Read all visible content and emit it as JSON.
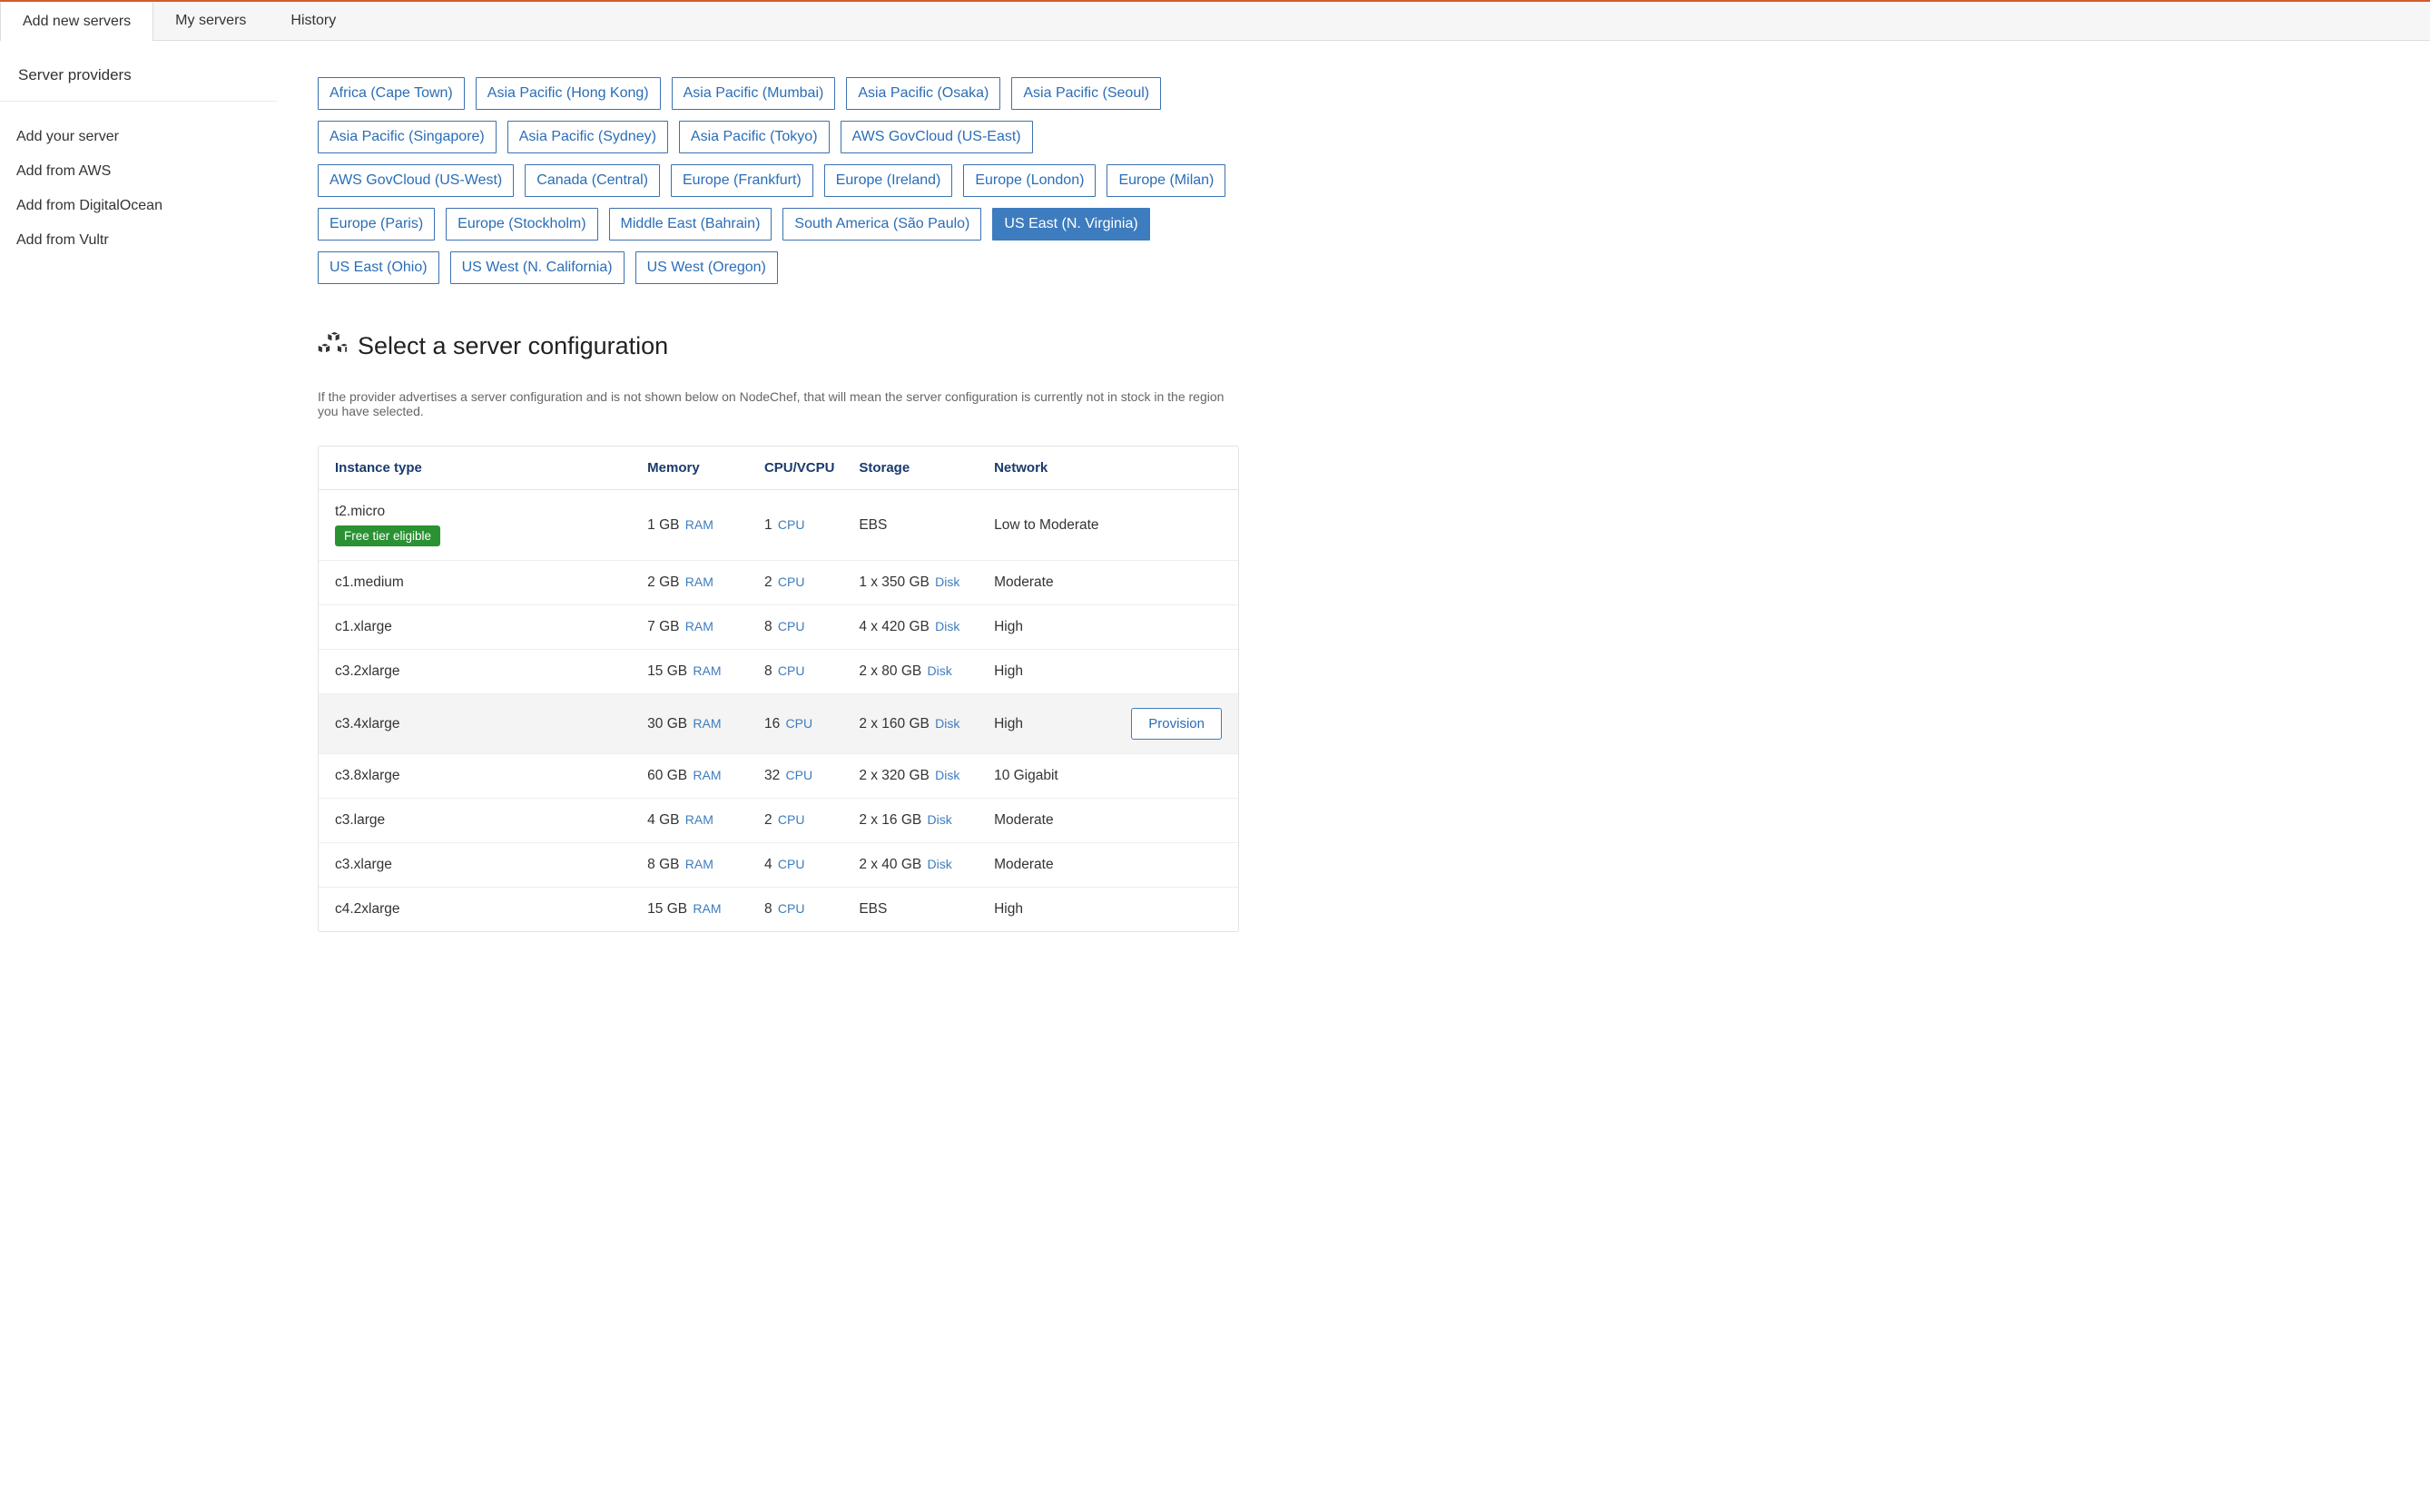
{
  "tabs": [
    {
      "label": "Add new servers",
      "active": true
    },
    {
      "label": "My servers",
      "active": false
    },
    {
      "label": "History",
      "active": false
    }
  ],
  "sidebar": {
    "header": "Server providers",
    "items": [
      {
        "label": "Add your server"
      },
      {
        "label": "Add from AWS"
      },
      {
        "label": "Add from DigitalOcean"
      },
      {
        "label": "Add from Vultr"
      }
    ]
  },
  "regions": [
    {
      "label": "Africa (Cape Town)"
    },
    {
      "label": "Asia Pacific (Hong Kong)"
    },
    {
      "label": "Asia Pacific (Mumbai)"
    },
    {
      "label": "Asia Pacific (Osaka)"
    },
    {
      "label": "Asia Pacific (Seoul)"
    },
    {
      "label": "Asia Pacific (Singapore)"
    },
    {
      "label": "Asia Pacific (Sydney)"
    },
    {
      "label": "Asia Pacific (Tokyo)"
    },
    {
      "label": "AWS GovCloud (US-East)"
    },
    {
      "label": "AWS GovCloud (US-West)"
    },
    {
      "label": "Canada (Central)"
    },
    {
      "label": "Europe (Frankfurt)"
    },
    {
      "label": "Europe (Ireland)"
    },
    {
      "label": "Europe (London)"
    },
    {
      "label": "Europe (Milan)"
    },
    {
      "label": "Europe (Paris)"
    },
    {
      "label": "Europe (Stockholm)"
    },
    {
      "label": "Middle East (Bahrain)"
    },
    {
      "label": "South America (São Paulo)"
    },
    {
      "label": "US East (N. Virginia)",
      "active": true
    },
    {
      "label": "US East (Ohio)"
    },
    {
      "label": "US West (N. California)"
    },
    {
      "label": "US West (Oregon)"
    }
  ],
  "config_section": {
    "title": "Select a server configuration",
    "note": "If the provider advertises a server configuration and is not shown below on NodeChef, that will mean the server configuration is currently not in stock in the region you have selected."
  },
  "table": {
    "headers": {
      "instance": "Instance type",
      "memory": "Memory",
      "cpu": "CPU/VCPU",
      "storage": "Storage",
      "network": "Network"
    },
    "units": {
      "ram": "RAM",
      "cpu": "CPU",
      "disk": "Disk"
    },
    "free_tier_label": "Free tier eligible",
    "provision_label": "Provision",
    "rows": [
      {
        "instance": "t2.micro",
        "free_tier": true,
        "memory": "1 GB",
        "mem_unit": "RAM",
        "cpu": "1",
        "cpu_unit": "CPU",
        "storage": "EBS",
        "storage_unit": "",
        "network": "Low to Moderate"
      },
      {
        "instance": "c1.medium",
        "memory": "2 GB",
        "mem_unit": "RAM",
        "cpu": "2",
        "cpu_unit": "CPU",
        "storage": "1 x 350 GB",
        "storage_unit": "Disk",
        "network": "Moderate"
      },
      {
        "instance": "c1.xlarge",
        "memory": "7 GB",
        "mem_unit": "RAM",
        "cpu": "8",
        "cpu_unit": "CPU",
        "storage": "4 x 420 GB",
        "storage_unit": "Disk",
        "network": "High"
      },
      {
        "instance": "c3.2xlarge",
        "memory": "15 GB",
        "mem_unit": "RAM",
        "cpu": "8",
        "cpu_unit": "CPU",
        "storage": "2 x 80 GB",
        "storage_unit": "Disk",
        "network": "High"
      },
      {
        "instance": "c3.4xlarge",
        "memory": "30 GB",
        "mem_unit": "RAM",
        "cpu": "16",
        "cpu_unit": "CPU",
        "storage": "2 x 160 GB",
        "storage_unit": "Disk",
        "network": "High",
        "highlighted": true,
        "show_provision": true
      },
      {
        "instance": "c3.8xlarge",
        "memory": "60 GB",
        "mem_unit": "RAM",
        "cpu": "32",
        "cpu_unit": "CPU",
        "storage": "2 x 320 GB",
        "storage_unit": "Disk",
        "network": "10 Gigabit"
      },
      {
        "instance": "c3.large",
        "memory": "4 GB",
        "mem_unit": "RAM",
        "cpu": "2",
        "cpu_unit": "CPU",
        "storage": "2 x 16 GB",
        "storage_unit": "Disk",
        "network": "Moderate"
      },
      {
        "instance": "c3.xlarge",
        "memory": "8 GB",
        "mem_unit": "RAM",
        "cpu": "4",
        "cpu_unit": "CPU",
        "storage": "2 x 40 GB",
        "storage_unit": "Disk",
        "network": "Moderate"
      },
      {
        "instance": "c4.2xlarge",
        "memory": "15 GB",
        "mem_unit": "RAM",
        "cpu": "8",
        "cpu_unit": "CPU",
        "storage": "EBS",
        "storage_unit": "",
        "network": "High"
      }
    ]
  }
}
